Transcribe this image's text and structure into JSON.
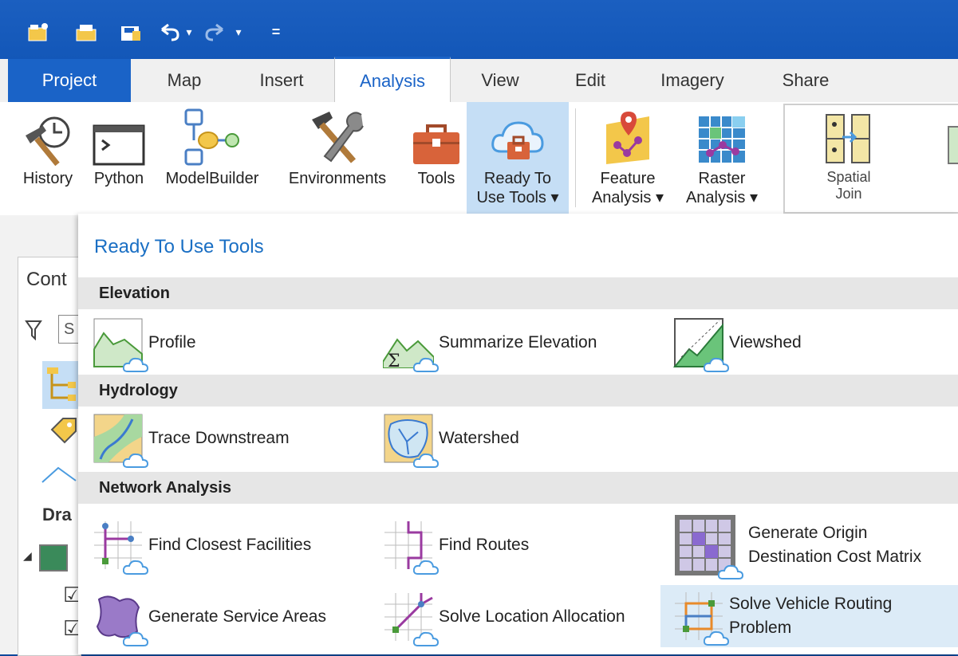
{
  "qat": {
    "icons": [
      "new-project-icon",
      "open-project-icon",
      "save-project-icon",
      "undo-icon",
      "undo-dropdown-icon",
      "redo-icon",
      "redo-dropdown-icon",
      "customize-qat-icon"
    ],
    "glyphs": {
      "undo_dd": "▾",
      "redo_dd": "▾",
      "customize": "="
    }
  },
  "tabs": [
    {
      "label": "Project"
    },
    {
      "label": "Map"
    },
    {
      "label": "Insert"
    },
    {
      "label": "Analysis"
    },
    {
      "label": "View"
    },
    {
      "label": "Edit"
    },
    {
      "label": "Imagery"
    },
    {
      "label": "Share"
    }
  ],
  "active_tab": "Analysis",
  "ribbon": {
    "history": "History",
    "python": "Python",
    "modelbuilder": "ModelBuilder",
    "environments": "Environments",
    "tools": "Tools",
    "ready_to_use_1": "Ready To",
    "ready_to_use_2": "Use Tools ▾",
    "feature_1": "Feature",
    "feature_2": "Analysis ▾",
    "raster_1": "Raster",
    "raster_2": "Analysis ▾",
    "spatial_1": "Spatial",
    "spatial_2": "Join"
  },
  "pane": {
    "contents_fragment": "Cont",
    "search_fragment": "S",
    "drawing_fragment": "Dra",
    "expand_glyph": "◢",
    "check_glyph": "☑"
  },
  "gallery": {
    "title": "Ready To Use Tools",
    "categories": {
      "elevation": "Elevation",
      "hydrology": "Hydrology",
      "network": "Network Analysis"
    },
    "tools": {
      "profile": "Profile",
      "summarize_elevation": "Summarize Elevation",
      "viewshed": "Viewshed",
      "trace_downstream": "Trace Downstream",
      "watershed": "Watershed",
      "find_closest": "Find Closest Facilities",
      "find_routes": "Find Routes",
      "od_matrix_1": "Generate Origin",
      "od_matrix_2": "Destination Cost Matrix",
      "service_areas": "Generate Service Areas",
      "location_allocation": "Solve Location Allocation",
      "vrp_1": "Solve Vehicle Routing",
      "vrp_2": "Problem"
    },
    "sigma": "Σ"
  },
  "colors": {
    "accent": "#1a63c7",
    "title_blue": "#1a6fc4",
    "selected_bg": "#c5def5",
    "cloud": "#4a9be0"
  }
}
